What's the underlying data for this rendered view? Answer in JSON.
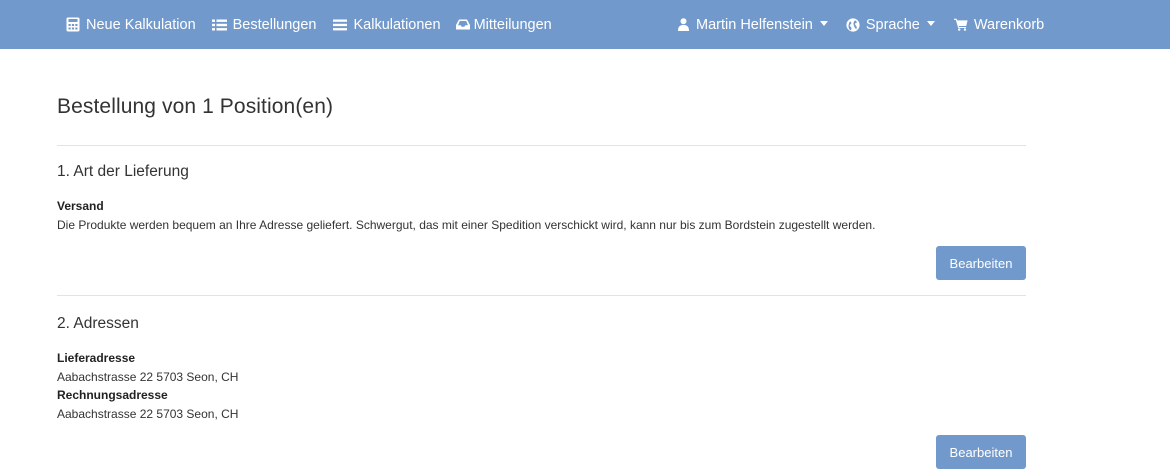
{
  "navbar": {
    "left_items": [
      {
        "label": "Neue Kalkulation",
        "icon": "calculator-icon"
      },
      {
        "label": "Bestellungen",
        "icon": "list-icon"
      },
      {
        "label": "Kalkulationen",
        "icon": "bars-icon"
      },
      {
        "label": "Mitteilungen",
        "icon": "inbox-icon"
      }
    ],
    "user": {
      "label": "Martin Helfenstein",
      "icon": "user-icon"
    },
    "language": {
      "label": "Sprache",
      "icon": "globe-icon"
    },
    "cart": {
      "label": "Warenkorb",
      "icon": "cart-icon"
    }
  },
  "page": {
    "title": "Bestellung von 1 Position(en)"
  },
  "delivery": {
    "heading": "1. Art der Lieferung",
    "method": "Versand",
    "description": "Die Produkte werden bequem an Ihre Adresse geliefert. Schwergut, das mit einer Spedition verschickt wird, kann nur bis zum Bordstein zugestellt werden.",
    "edit_label": "Bearbeiten"
  },
  "addresses": {
    "heading": "2. Adressen",
    "delivery_label": "Lieferadresse",
    "delivery_address": "Aabachstrasse 22 5703 Seon, CH",
    "billing_label": "Rechnungsadresse",
    "billing_address": "Aabachstrasse 22 5703 Seon, CH",
    "edit_label": "Bearbeiten"
  },
  "colors": {
    "navbar": "#7299cb",
    "button": "#7299cb"
  }
}
